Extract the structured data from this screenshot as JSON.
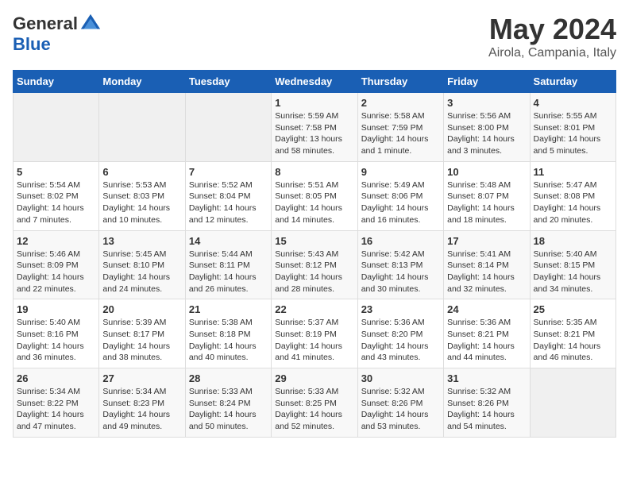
{
  "header": {
    "logo_general": "General",
    "logo_blue": "Blue",
    "month": "May 2024",
    "location": "Airola, Campania, Italy"
  },
  "days_of_week": [
    "Sunday",
    "Monday",
    "Tuesday",
    "Wednesday",
    "Thursday",
    "Friday",
    "Saturday"
  ],
  "weeks": [
    [
      {
        "day": "",
        "info": ""
      },
      {
        "day": "",
        "info": ""
      },
      {
        "day": "",
        "info": ""
      },
      {
        "day": "1",
        "info": "Sunrise: 5:59 AM\nSunset: 7:58 PM\nDaylight: 13 hours and 58 minutes."
      },
      {
        "day": "2",
        "info": "Sunrise: 5:58 AM\nSunset: 7:59 PM\nDaylight: 14 hours and 1 minute."
      },
      {
        "day": "3",
        "info": "Sunrise: 5:56 AM\nSunset: 8:00 PM\nDaylight: 14 hours and 3 minutes."
      },
      {
        "day": "4",
        "info": "Sunrise: 5:55 AM\nSunset: 8:01 PM\nDaylight: 14 hours and 5 minutes."
      }
    ],
    [
      {
        "day": "5",
        "info": "Sunrise: 5:54 AM\nSunset: 8:02 PM\nDaylight: 14 hours and 7 minutes."
      },
      {
        "day": "6",
        "info": "Sunrise: 5:53 AM\nSunset: 8:03 PM\nDaylight: 14 hours and 10 minutes."
      },
      {
        "day": "7",
        "info": "Sunrise: 5:52 AM\nSunset: 8:04 PM\nDaylight: 14 hours and 12 minutes."
      },
      {
        "day": "8",
        "info": "Sunrise: 5:51 AM\nSunset: 8:05 PM\nDaylight: 14 hours and 14 minutes."
      },
      {
        "day": "9",
        "info": "Sunrise: 5:49 AM\nSunset: 8:06 PM\nDaylight: 14 hours and 16 minutes."
      },
      {
        "day": "10",
        "info": "Sunrise: 5:48 AM\nSunset: 8:07 PM\nDaylight: 14 hours and 18 minutes."
      },
      {
        "day": "11",
        "info": "Sunrise: 5:47 AM\nSunset: 8:08 PM\nDaylight: 14 hours and 20 minutes."
      }
    ],
    [
      {
        "day": "12",
        "info": "Sunrise: 5:46 AM\nSunset: 8:09 PM\nDaylight: 14 hours and 22 minutes."
      },
      {
        "day": "13",
        "info": "Sunrise: 5:45 AM\nSunset: 8:10 PM\nDaylight: 14 hours and 24 minutes."
      },
      {
        "day": "14",
        "info": "Sunrise: 5:44 AM\nSunset: 8:11 PM\nDaylight: 14 hours and 26 minutes."
      },
      {
        "day": "15",
        "info": "Sunrise: 5:43 AM\nSunset: 8:12 PM\nDaylight: 14 hours and 28 minutes."
      },
      {
        "day": "16",
        "info": "Sunrise: 5:42 AM\nSunset: 8:13 PM\nDaylight: 14 hours and 30 minutes."
      },
      {
        "day": "17",
        "info": "Sunrise: 5:41 AM\nSunset: 8:14 PM\nDaylight: 14 hours and 32 minutes."
      },
      {
        "day": "18",
        "info": "Sunrise: 5:40 AM\nSunset: 8:15 PM\nDaylight: 14 hours and 34 minutes."
      }
    ],
    [
      {
        "day": "19",
        "info": "Sunrise: 5:40 AM\nSunset: 8:16 PM\nDaylight: 14 hours and 36 minutes."
      },
      {
        "day": "20",
        "info": "Sunrise: 5:39 AM\nSunset: 8:17 PM\nDaylight: 14 hours and 38 minutes."
      },
      {
        "day": "21",
        "info": "Sunrise: 5:38 AM\nSunset: 8:18 PM\nDaylight: 14 hours and 40 minutes."
      },
      {
        "day": "22",
        "info": "Sunrise: 5:37 AM\nSunset: 8:19 PM\nDaylight: 14 hours and 41 minutes."
      },
      {
        "day": "23",
        "info": "Sunrise: 5:36 AM\nSunset: 8:20 PM\nDaylight: 14 hours and 43 minutes."
      },
      {
        "day": "24",
        "info": "Sunrise: 5:36 AM\nSunset: 8:21 PM\nDaylight: 14 hours and 44 minutes."
      },
      {
        "day": "25",
        "info": "Sunrise: 5:35 AM\nSunset: 8:21 PM\nDaylight: 14 hours and 46 minutes."
      }
    ],
    [
      {
        "day": "26",
        "info": "Sunrise: 5:34 AM\nSunset: 8:22 PM\nDaylight: 14 hours and 47 minutes."
      },
      {
        "day": "27",
        "info": "Sunrise: 5:34 AM\nSunset: 8:23 PM\nDaylight: 14 hours and 49 minutes."
      },
      {
        "day": "28",
        "info": "Sunrise: 5:33 AM\nSunset: 8:24 PM\nDaylight: 14 hours and 50 minutes."
      },
      {
        "day": "29",
        "info": "Sunrise: 5:33 AM\nSunset: 8:25 PM\nDaylight: 14 hours and 52 minutes."
      },
      {
        "day": "30",
        "info": "Sunrise: 5:32 AM\nSunset: 8:26 PM\nDaylight: 14 hours and 53 minutes."
      },
      {
        "day": "31",
        "info": "Sunrise: 5:32 AM\nSunset: 8:26 PM\nDaylight: 14 hours and 54 minutes."
      },
      {
        "day": "",
        "info": ""
      }
    ]
  ]
}
